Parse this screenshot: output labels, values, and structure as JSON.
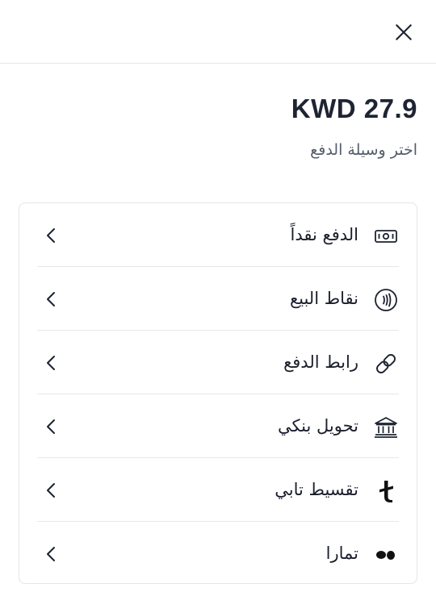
{
  "header": {
    "close_icon": "close-icon"
  },
  "summary": {
    "amount": "KWD 27.9",
    "subtitle": "اختر وسيلة الدفع"
  },
  "methods": [
    {
      "label": "الدفع نقداً",
      "icon": "cash-icon"
    },
    {
      "label": "نقاط البيع",
      "icon": "contactless-icon"
    },
    {
      "label": "رابط الدفع",
      "icon": "link-icon"
    },
    {
      "label": "تحويل بنكي",
      "icon": "bank-icon"
    },
    {
      "label": "تقسيط تابي",
      "icon": "tabby-icon"
    },
    {
      "label": "تمارا",
      "icon": "tamara-icon"
    }
  ],
  "colors": {
    "text_primary": "#1d2230",
    "text_secondary": "#555c6a",
    "divider": "#e7e8eb"
  }
}
